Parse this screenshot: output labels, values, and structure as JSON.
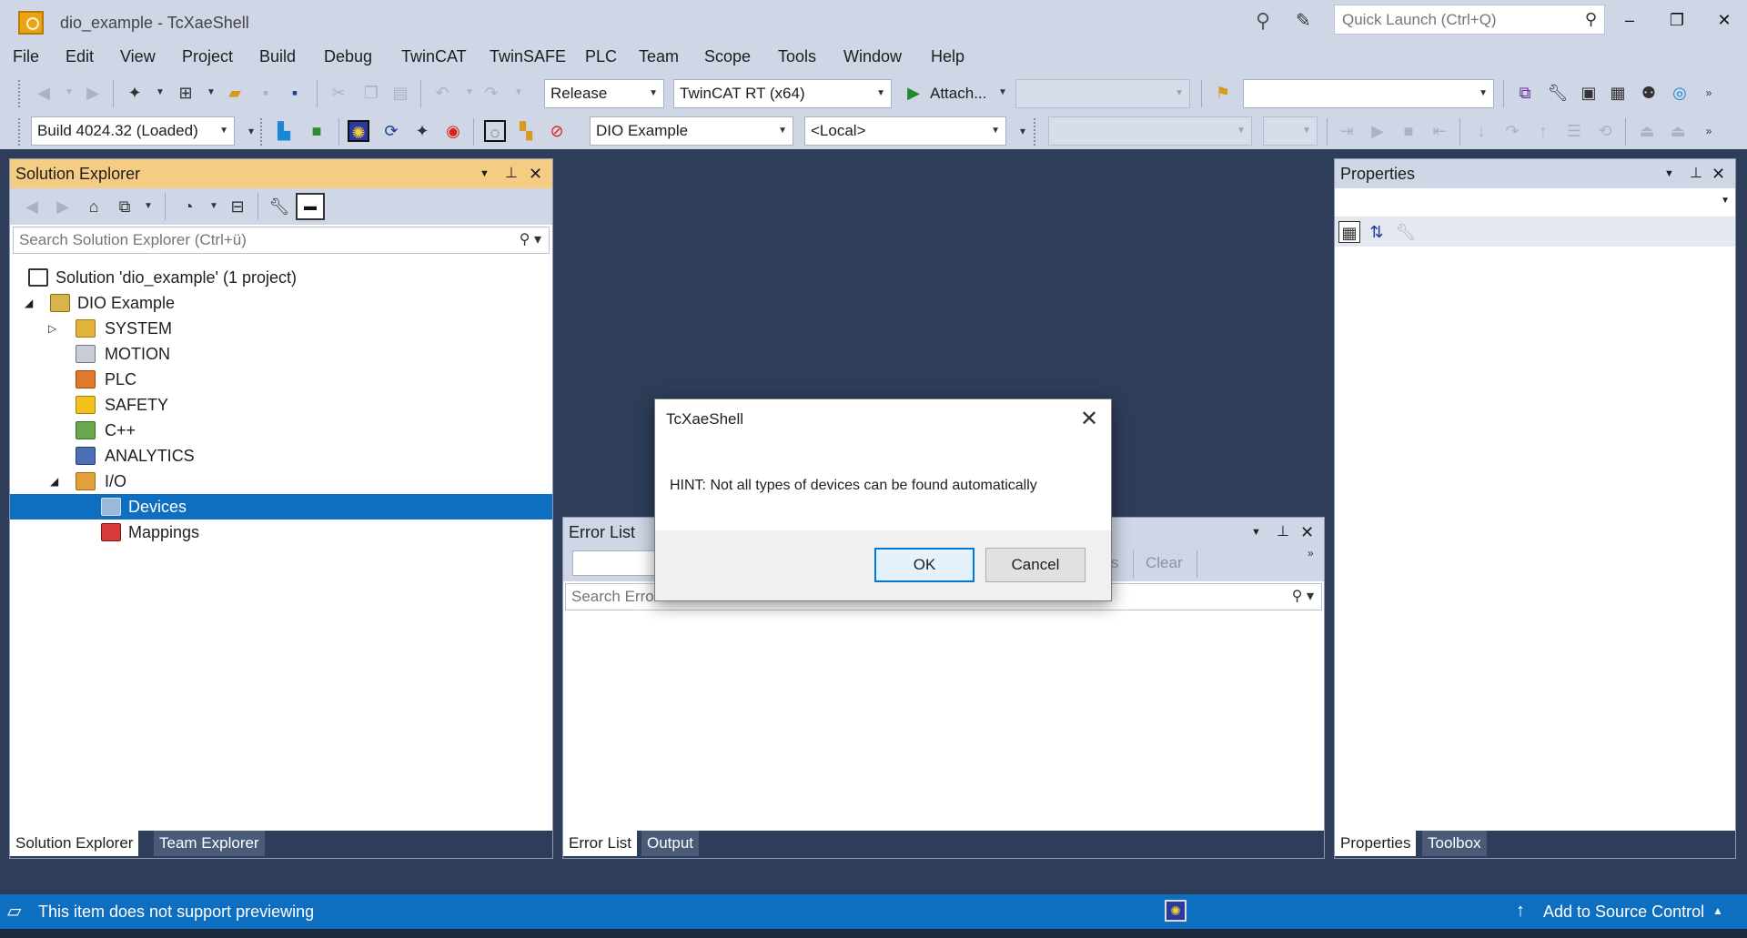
{
  "window": {
    "title": "dio_example - TcXaeShell",
    "quick_launch_placeholder": "Quick Launch (Ctrl+Q)",
    "minimize": "‒",
    "restore": "❐",
    "close": "✕"
  },
  "menu": [
    "File",
    "Edit",
    "View",
    "Project",
    "Build",
    "Debug",
    "TwinCAT",
    "TwinSAFE",
    "PLC",
    "Team",
    "Scope",
    "Tools",
    "Window",
    "Help"
  ],
  "toolbar1": {
    "configuration": "Release",
    "platform": "TwinCAT RT (x64)",
    "attach_label": "Attach...",
    "empty_combo_1": "",
    "empty_combo_2": ""
  },
  "toolbar2": {
    "build_version": "Build 4024.32 (Loaded)",
    "project": "DIO Example",
    "target": "<Local>"
  },
  "solution_explorer": {
    "title": "Solution Explorer",
    "search_placeholder": "Search Solution Explorer (Ctrl+ü)",
    "tree": {
      "solution": "Solution 'dio_example' (1 project)",
      "project": "DIO Example",
      "system": "SYSTEM",
      "motion": "MOTION",
      "plc": "PLC",
      "safety": "SAFETY",
      "cpp": "C++",
      "analytics": "ANALYTICS",
      "io": "I/O",
      "devices": "Devices",
      "mappings": "Mappings"
    },
    "tabs": [
      "Solution Explorer",
      "Team Explorer"
    ]
  },
  "properties": {
    "title": "Properties",
    "tabs": [
      "Properties",
      "Toolbox"
    ]
  },
  "error_list": {
    "title": "Error List",
    "search_placeholder": "Search Error List",
    "messages_fragment": "s",
    "clear_label": "Clear",
    "tabs": [
      "Error List",
      "Output"
    ]
  },
  "dialog": {
    "title": "TcXaeShell",
    "message": "HINT: Not all types of devices can be found automatically",
    "ok": "OK",
    "cancel": "Cancel"
  },
  "status": {
    "message": "This item does not support previewing",
    "source_control": "Add to Source Control"
  },
  "colors": {
    "accent": "#0e6fc0",
    "chrome": "#cfd6e5",
    "workspace": "#2e3e5a",
    "active_header": "#f5cc84"
  }
}
